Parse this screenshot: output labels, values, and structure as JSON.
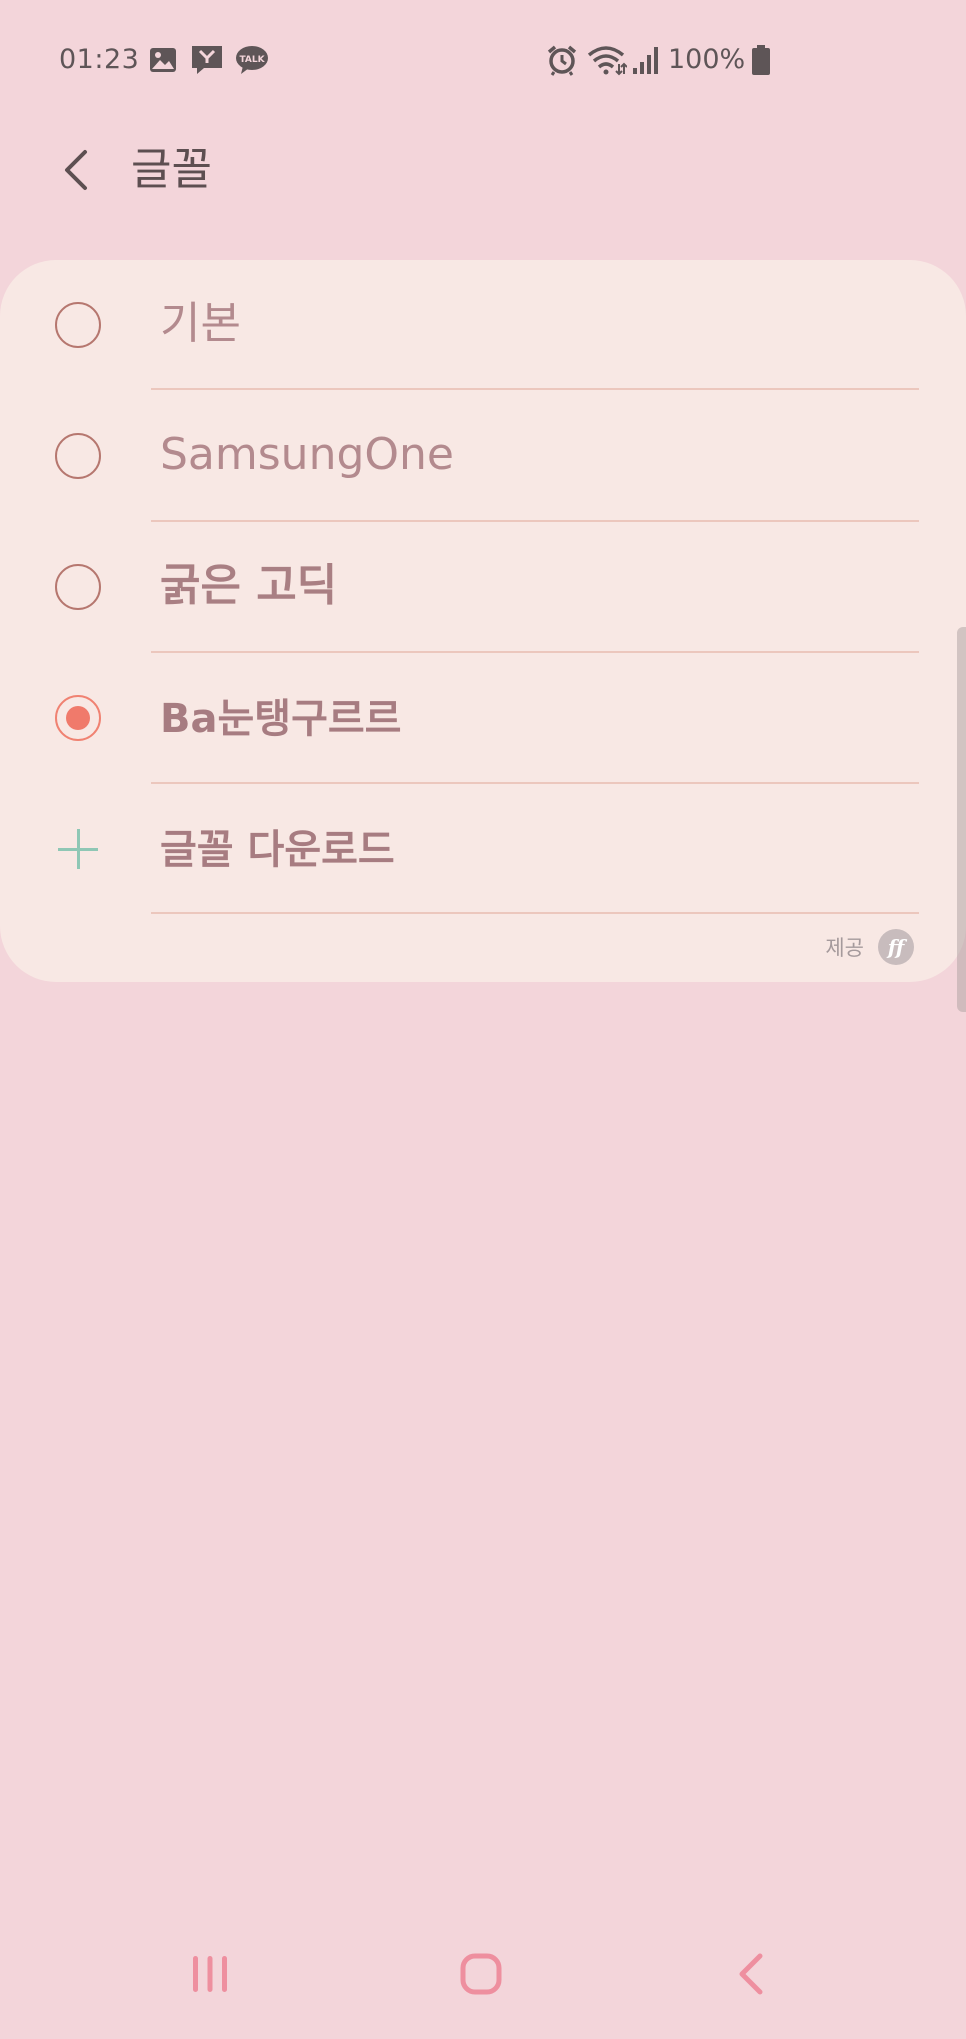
{
  "status_bar": {
    "time": "01:23",
    "battery_text": "100%",
    "icons": [
      "gallery-icon",
      "missed-call-icon",
      "kakaotalk-icon",
      "alarm-icon",
      "wifi-icon",
      "signal-icon",
      "battery-icon"
    ],
    "talk_icon_text": "TALK"
  },
  "header": {
    "title": "글꼴",
    "back_icon": "chevron-left-icon"
  },
  "font_options": [
    {
      "label": "기본",
      "selected": false
    },
    {
      "label": "SamsungOne",
      "selected": false
    },
    {
      "label": "굵은 고딕",
      "selected": false
    },
    {
      "label": "Ba눈탱구르르",
      "selected": true
    }
  ],
  "download": {
    "label": "글꼴 다운로드",
    "icon": "plus-icon"
  },
  "provider": {
    "label": "제공",
    "logo_text": "ff"
  },
  "nav_bar": {
    "items": [
      "recents-icon",
      "home-icon",
      "back-icon"
    ]
  },
  "colors": {
    "background": "#f3d5da",
    "card": "#f8e8e4",
    "accent": "#f07a6b",
    "plus": "#8fc7b5",
    "nav": "#ee8f9f"
  }
}
